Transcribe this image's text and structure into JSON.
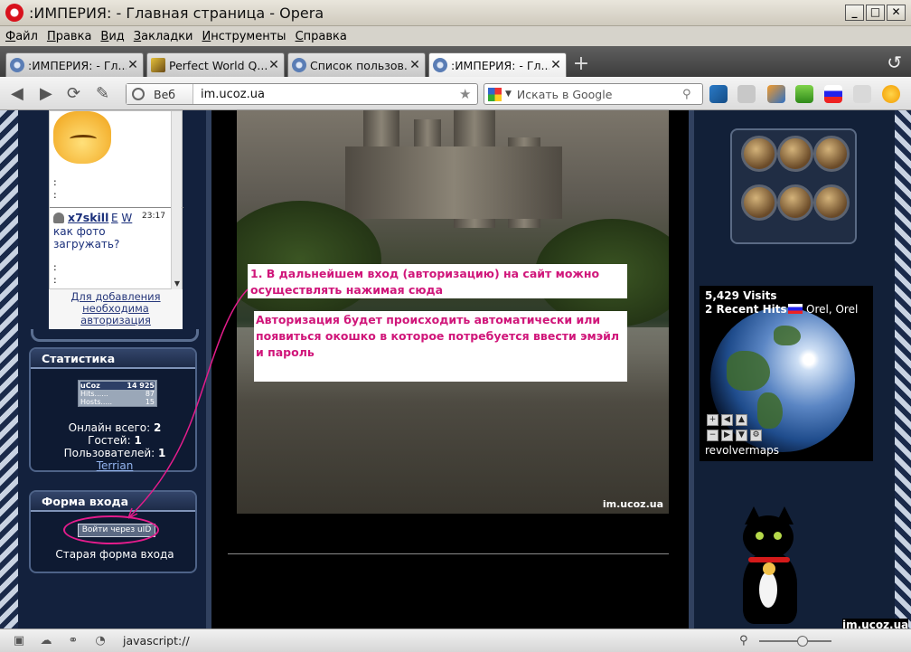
{
  "window": {
    "title": ":ИМПЕРИЯ: - Главная страница - Opera",
    "controls": [
      "_",
      "□",
      "✕"
    ]
  },
  "menu": [
    "Файл",
    "Правка",
    "Вид",
    "Закладки",
    "Инструменты",
    "Справка"
  ],
  "tabs": [
    {
      "label": ":ИМПЕРИЯ: - Гл...",
      "icon": "opera-site-icon",
      "active": false
    },
    {
      "label": "Perfect World Q...",
      "icon": "perfect-world-icon",
      "active": false
    },
    {
      "label": "Список пользов...",
      "icon": "opera-site-icon",
      "active": false
    },
    {
      "label": ":ИМПЕРИЯ: - Гл...",
      "icon": "opera-site-icon",
      "active": true
    }
  ],
  "address": {
    "scope_label": "Веб",
    "url": "im.ucoz.ua",
    "search_placeholder": "Искать в Google"
  },
  "chat": {
    "dots1": ":",
    "dots2": ":",
    "user": "x7skill",
    "e": "E",
    "w": "W",
    "time": "23:17",
    "message": "как фото загружать?",
    "dots3": ":",
    "dots4": ":",
    "add_note": "Для добавления необходима авторизация"
  },
  "stats": {
    "title": "Статистика",
    "counter": {
      "brand": "uCoz",
      "brand_value": "14 925",
      "hits_label": "Hits......",
      "hits": "87",
      "hosts_label": "Hosts.....",
      "hosts": "15"
    },
    "online_label": "Онлайн всего:",
    "online": "2",
    "guests_label": "Гостей:",
    "guests": "1",
    "users_label": "Пользователей:",
    "users": "1",
    "user_name": "Terrian"
  },
  "login": {
    "title": "Форма входа",
    "uid_button": "Войти через uID",
    "old_form": "Старая форма входа"
  },
  "main": {
    "watermark": "im.ucoz.ua",
    "note1": "1. В дальнейшем вход (авторизацию) на сайт можно осуществлять нажимая сюда",
    "note2": "Авторизация будет происходить автоматически или появиться окошко в которое потребуется ввести эмэйл и пароль"
  },
  "visits": {
    "visits": "5,429 Visits",
    "recent": "2 Recent Hits",
    "location": "Orel, Orel",
    "brand": "revolvermaps"
  },
  "bottom_watermark": "im.ucoz.ua",
  "status": {
    "text": "javascript://"
  },
  "colors": {
    "annotation": "#d0167a",
    "page_bg": "#0f1b33",
    "link": "#93b4ef"
  }
}
